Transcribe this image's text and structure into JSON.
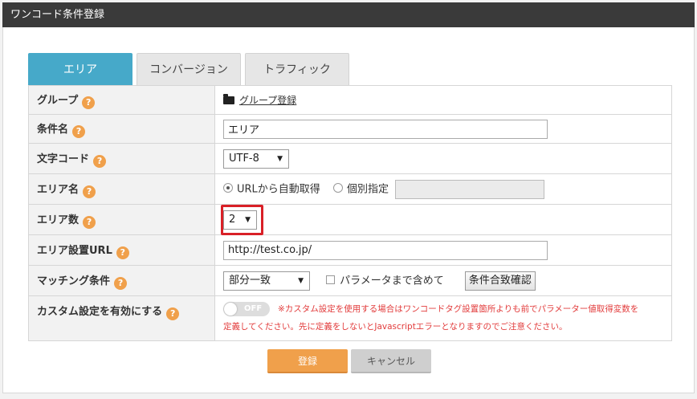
{
  "window": {
    "title": "ワンコード条件登録"
  },
  "tabs": [
    {
      "label": "エリア",
      "active": true
    },
    {
      "label": "コンバージョン",
      "active": false
    },
    {
      "label": "トラフィック",
      "active": false
    }
  ],
  "help_glyph": "?",
  "form": {
    "group": {
      "label": "グループ",
      "link": "グループ登録"
    },
    "condition_name": {
      "label": "条件名",
      "value": "エリア"
    },
    "charset": {
      "label": "文字コード",
      "value": "UTF-8"
    },
    "area_name": {
      "label": "エリア名",
      "option_auto": "URLから自動取得",
      "option_manual": "個別指定",
      "manual_value": ""
    },
    "area_count": {
      "label": "エリア数",
      "value": "2"
    },
    "area_url": {
      "label": "エリア設置URL",
      "value": "http://test.co.jp/"
    },
    "matching": {
      "label": "マッチング条件",
      "value": "部分一致",
      "checkbox_label": "パラメータまで含めて",
      "check_button": "条件合致確認"
    },
    "custom": {
      "label": "カスタム設定を有効にする",
      "toggle_label": "OFF",
      "warning_line1": "※カスタム設定を使用する場合はワンコードタグ設置箇所よりも前でパラメーター値取得変数を",
      "warning_line2": "定義してください。先に定義をしないとJavascriptエラーとなりますのでご注意ください。"
    }
  },
  "actions": {
    "submit": "登録",
    "cancel": "キャンセル"
  },
  "colors": {
    "accent": "#46a9c9",
    "primary_button": "#f0a04b",
    "highlight": "#d92027",
    "warning": "#e23c3c"
  }
}
